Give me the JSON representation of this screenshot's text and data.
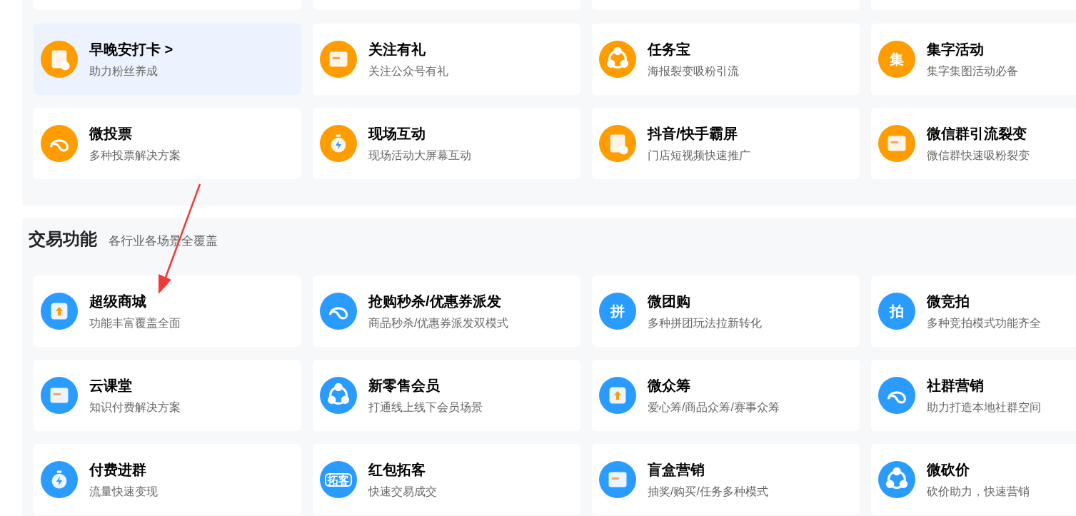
{
  "sections": [
    {
      "color": "#ff9c00",
      "items": [
        {
          "title": "早晚安打卡 >",
          "subtitle": "助力粉丝养成",
          "selected": true
        },
        {
          "title": "关注有礼",
          "subtitle": "关注公众号有礼",
          "selected": false
        },
        {
          "title": "任务宝",
          "subtitle": "海报裂变吸粉引流",
          "selected": false
        },
        {
          "title": "集字活动",
          "subtitle": "集字集图活动必备",
          "selected": false,
          "icon_text": "集"
        },
        {
          "title": "微投票",
          "subtitle": "多种投票解决方案",
          "selected": false
        },
        {
          "title": "现场互动",
          "subtitle": "现场活动大屏幕互动",
          "selected": false
        },
        {
          "title": "抖音/快手霸屏",
          "subtitle": "门店短视频快速推广",
          "selected": false
        },
        {
          "title": "微信群引流裂变",
          "subtitle": "微信群快速吸粉裂变",
          "selected": false
        }
      ]
    },
    {
      "title": "交易功能",
      "subtitle": "各行业各场景全覆盖",
      "color": "#2a9bff",
      "items": [
        {
          "title": "超级商城",
          "subtitle": "功能丰富覆盖全面",
          "selected": false
        },
        {
          "title": "抢购秒杀/优惠券派发",
          "subtitle": "商品秒杀/优惠券派发双模式",
          "selected": false
        },
        {
          "title": "微团购",
          "subtitle": "多种拼团玩法拉新转化",
          "selected": false,
          "icon_text": "拼"
        },
        {
          "title": "微竞拍",
          "subtitle": "多种竞拍模式功能齐全",
          "selected": false,
          "icon_text": "拍"
        },
        {
          "title": "云课堂",
          "subtitle": "知识付费解决方案",
          "selected": false
        },
        {
          "title": "新零售会员",
          "subtitle": "打通线上线下会员场景",
          "selected": false
        },
        {
          "title": "微众筹",
          "subtitle": "爱心筹/商品众筹/赛事众筹",
          "selected": false
        },
        {
          "title": "社群营销",
          "subtitle": "助力打造本地社群空间",
          "selected": false
        },
        {
          "title": "付费进群",
          "subtitle": "流量快速变现",
          "selected": false
        },
        {
          "title": "红包拓客",
          "subtitle": "快速交易成交",
          "selected": false,
          "icon_text": "拓客"
        },
        {
          "title": "盲盒营销",
          "subtitle": "抽奖/购买/任务多种模式",
          "selected": false
        },
        {
          "title": "微砍价",
          "subtitle": "砍价助力，快速营销",
          "selected": false
        }
      ]
    }
  ]
}
